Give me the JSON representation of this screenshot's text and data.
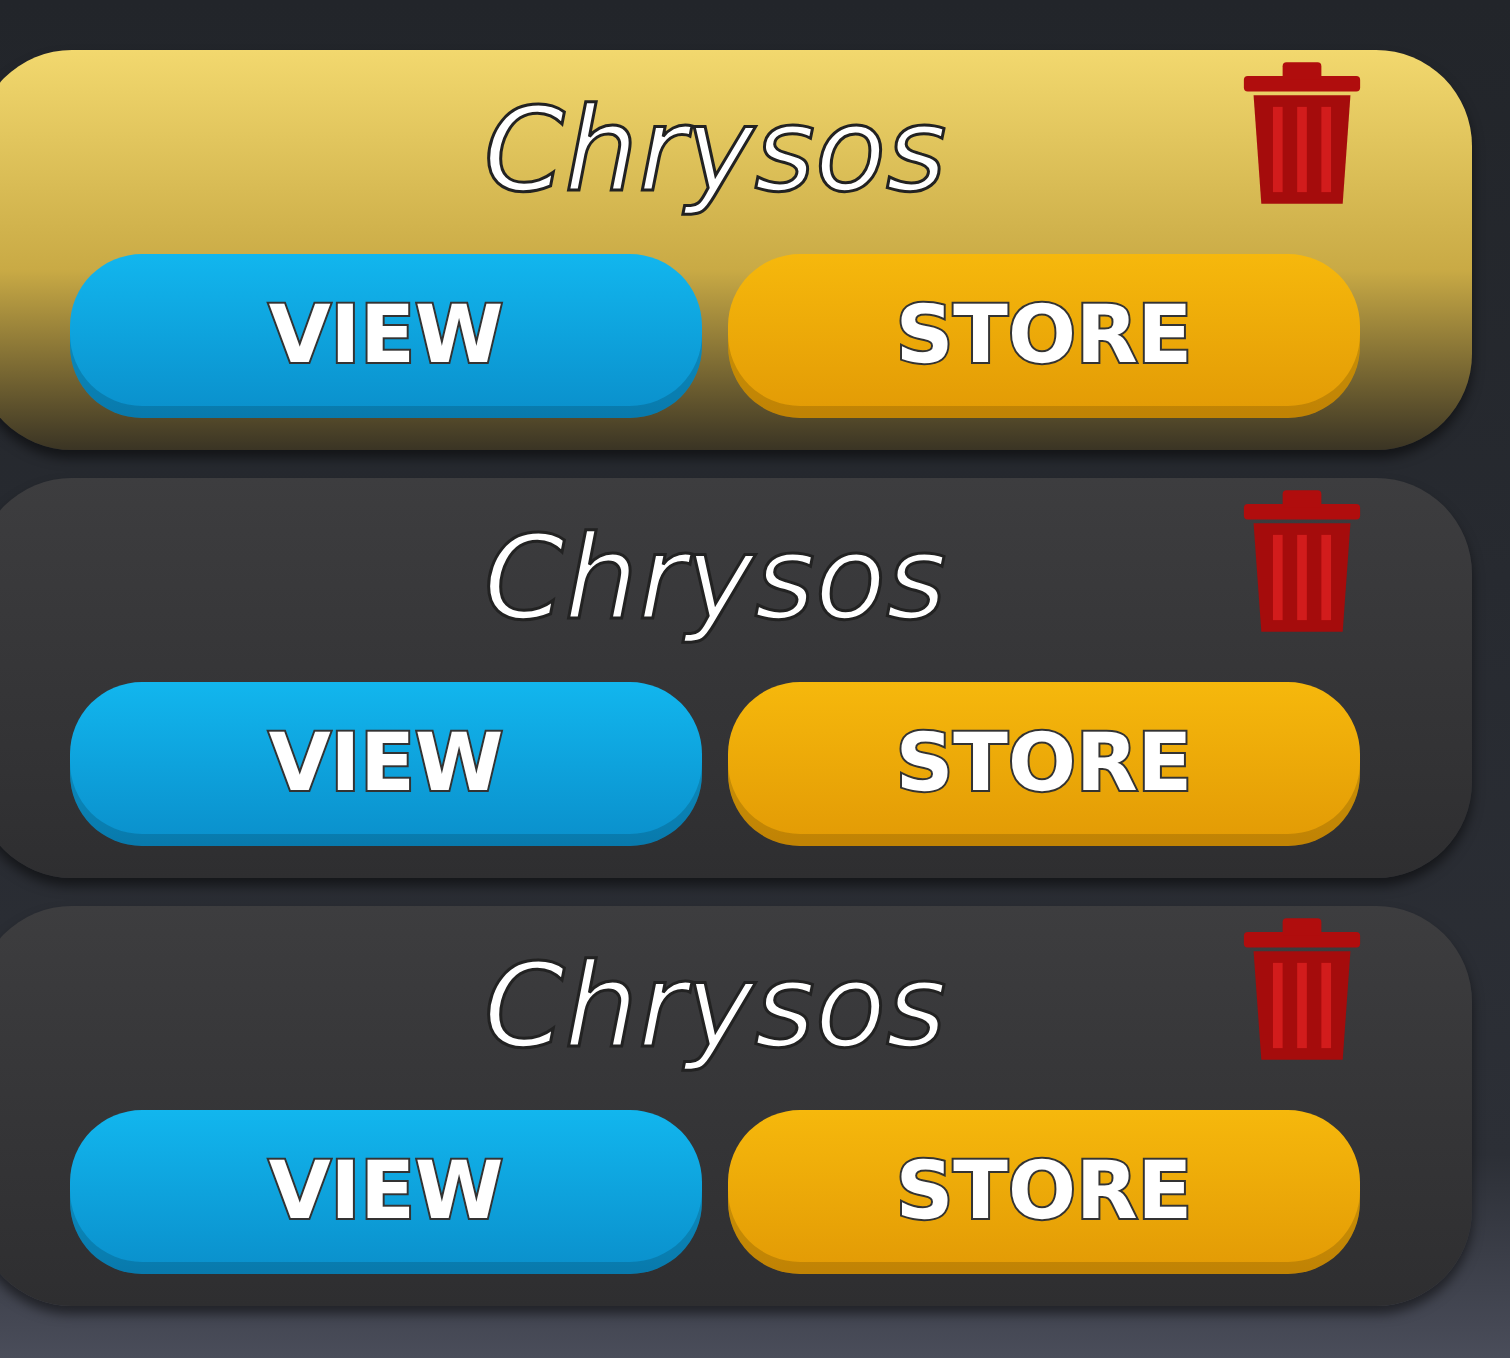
{
  "slots": [
    {
      "name": "Chrysos",
      "selected": true,
      "buttons": [
        {
          "label": "VIEW",
          "kind": "view"
        },
        {
          "label": "STORE",
          "kind": "store"
        }
      ]
    },
    {
      "name": "Chrysos",
      "selected": false,
      "buttons": [
        {
          "label": "VIEW",
          "kind": "view"
        },
        {
          "label": "STORE",
          "kind": "store"
        }
      ]
    },
    {
      "name": "Chrysos",
      "selected": false,
      "buttons": [
        {
          "label": "VIEW",
          "kind": "view"
        },
        {
          "label": "STORE",
          "kind": "store"
        }
      ]
    }
  ]
}
